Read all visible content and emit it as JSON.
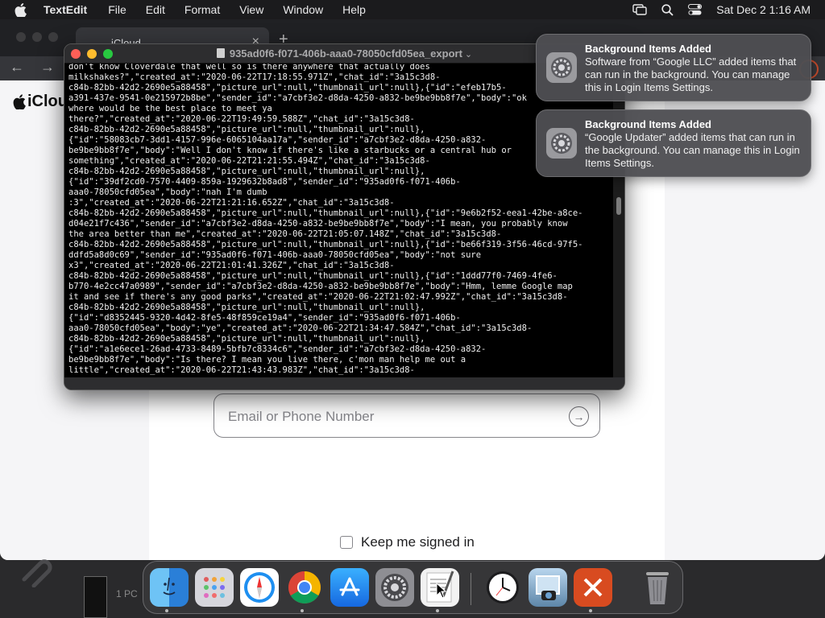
{
  "menubar": {
    "app_name": "TextEdit",
    "items": [
      "File",
      "Edit",
      "Format",
      "View",
      "Window",
      "Help"
    ],
    "clock": "Sat Dec 2  1:16 AM"
  },
  "browser": {
    "tab_title": "iCloud",
    "page_logo_text": "iCloud",
    "email_placeholder": "Email or Phone Number",
    "keep_signed_in": "Keep me signed in"
  },
  "textedit": {
    "title": "935ad0f6-f071-406b-aaa0-78050cfd05ea_export",
    "lines": [
      "don't know Cloverdale that well so is there anywhere that actually does",
      "milkshakes?\",\"created_at\":\"2020-06-22T17:18:55.971Z\",\"chat_id\":\"3a15c3d8-",
      "c84b-82bb-42d2-2690e5a88458\",\"picture_url\":null,\"thumbnail_url\":null},{\"id\":\"efeb17b5-",
      "a391-437e-9541-0e215972b8be\",\"sender_id\":\"a7cbf3e2-d8da-4250-a832-be9be9bb8f7e\",\"body\":\"ok",
      "where would be the best place to meet ya",
      "there?\",\"created_at\":\"2020-06-22T19:49:59.588Z\",\"chat_id\":\"3a15c3d8-",
      "c84b-82bb-42d2-2690e5a88458\",\"picture_url\":null,\"thumbnail_url\":null},",
      "{\"id\":\"58083cb7-3dd1-4157-996e-6065104aa17a\",\"sender_id\":\"a7cbf3e2-d8da-4250-a832-",
      "be9be9bb8f7e\",\"body\":\"Well I don't know if there's like a starbucks or a central hub or",
      "something\",\"created_at\":\"2020-06-22T21:21:55.494Z\",\"chat_id\":\"3a15c3d8-",
      "c84b-82bb-42d2-2690e5a88458\",\"picture_url\":null,\"thumbnail_url\":null},",
      "{\"id\":\"39df2cd0-7570-4409-859a-1929632b8ad8\",\"sender_id\":\"935ad0f6-f071-406b-",
      "aaa0-78050cfd05ea\",\"body\":\"nah I'm dumb",
      ":3\",\"created_at\":\"2020-06-22T21:21:16.652Z\",\"chat_id\":\"3a15c3d8-",
      "c84b-82bb-42d2-2690e5a88458\",\"picture_url\":null,\"thumbnail_url\":null},{\"id\":\"9e6b2f52-eea1-42be-a8ce-",
      "d04e21f7c436\",\"sender_id\":\"a7cbf3e2-d8da-4250-a832-be9be9bb8f7e\",\"body\":\"I mean, you probably know",
      "the area better than me\",\"created_at\":\"2020-06-22T21:05:07.148Z\",\"chat_id\":\"3a15c3d8-",
      "c84b-82bb-42d2-2690e5a88458\",\"picture_url\":null,\"thumbnail_url\":null},{\"id\":\"be66f319-3f56-46cd-97f5-",
      "ddfd5a8d0c69\",\"sender_id\":\"935ad0f6-f071-406b-aaa0-78050cfd05ea\",\"body\":\"not sure",
      "x3\",\"created_at\":\"2020-06-22T21:01:41.326Z\",\"chat_id\":\"3a15c3d8-",
      "c84b-82bb-42d2-2690e5a88458\",\"picture_url\":null,\"thumbnail_url\":null},{\"id\":\"1ddd77f0-7469-4fe6-",
      "b770-4e2cc47a0989\",\"sender_id\":\"a7cbf3e2-d8da-4250-a832-be9be9bb8f7e\",\"body\":\"Hmm, lemme Google map",
      "it and see if there's any good parks\",\"created_at\":\"2020-06-22T21:02:47.992Z\",\"chat_id\":\"3a15c3d8-",
      "c84b-82bb-42d2-2690e5a88458\",\"picture_url\":null,\"thumbnail_url\":null},",
      "{\"id\":\"d8352445-9320-4d42-8fe5-48f859ce19a4\",\"sender_id\":\"935ad0f6-f071-406b-",
      "aaa0-78050cfd05ea\",\"body\":\"ye\",\"created_at\":\"2020-06-22T21:34:47.584Z\",\"chat_id\":\"3a15c3d8-",
      "c84b-82bb-42d2-2690e5a88458\",\"picture_url\":null,\"thumbnail_url\":null},",
      "{\"id\":\"a1e6ece1-26ad-4733-8489-5bfb7c8334c6\",\"sender_id\":\"a7cbf3e2-d8da-4250-a832-",
      "be9be9bb8f7e\",\"body\":\"Is there? I mean you live there, c'mon man help me out a",
      "little\",\"created_at\":\"2020-06-22T21:43:43.983Z\",\"chat_id\":\"3a15c3d8-"
    ]
  },
  "notifications": [
    {
      "title": "Background Items Added",
      "body": "Software from “Google LLC” added items that can run in the background. You can manage this in Login Items Settings."
    },
    {
      "title": "Background Items Added",
      "body": "“Google Updater” added items that can run in the background. You can manage this in Login Items Settings."
    }
  ],
  "desktop": {
    "side_label": "1 PC"
  },
  "dock": {
    "items": [
      {
        "name": "finder-icon",
        "color": "#3a8ee6"
      },
      {
        "name": "launchpad-icon",
        "color": "#d6d6dc"
      },
      {
        "name": "safari-icon",
        "color": "#2d9bf0"
      },
      {
        "name": "chrome-icon",
        "color": "#ffffff"
      },
      {
        "name": "app-store-icon",
        "color": "#1f8ff2"
      },
      {
        "name": "system-settings-icon",
        "color": "#8e8e93"
      },
      {
        "name": "textedit-icon",
        "color": "#f2f2f2"
      },
      {
        "name": "clock-icon",
        "color": "#1c1c1e"
      },
      {
        "name": "preview-icon",
        "color": "#8fb7d6"
      },
      {
        "name": "remote-desktop-icon",
        "color": "#d84b20"
      },
      {
        "name": "trash-icon",
        "color": "#8e8e93"
      }
    ]
  }
}
